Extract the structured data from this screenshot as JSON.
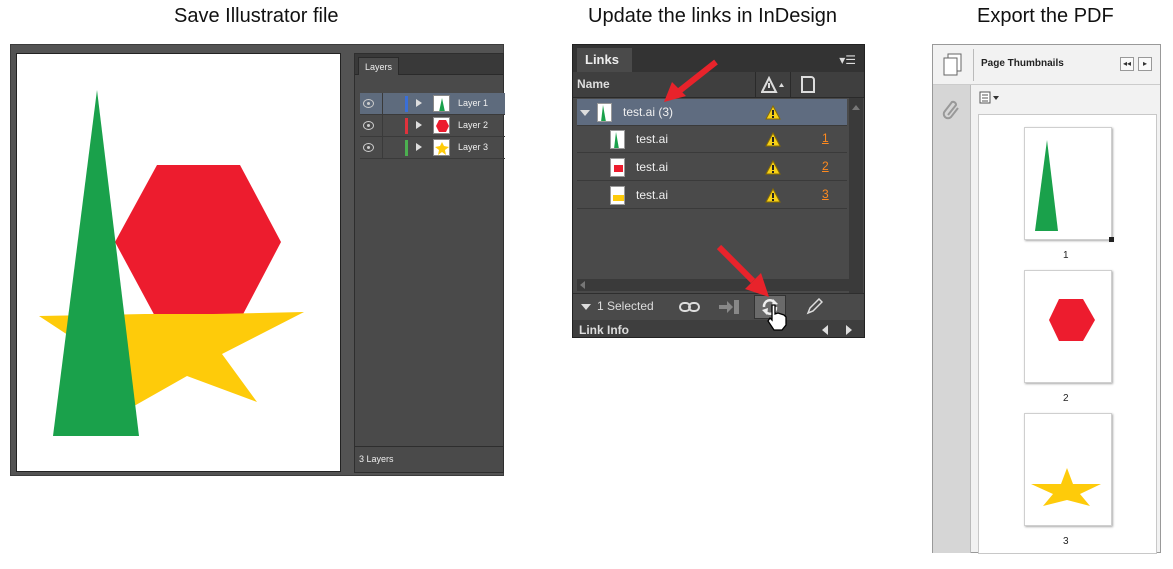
{
  "captions": {
    "illustrator": "Save Illustrator file",
    "indesign": "Update the links in InDesign",
    "pdf": "Export the PDF"
  },
  "illustrator": {
    "layers_tab": "Layers",
    "layers": [
      {
        "name": "Layer 1",
        "color": "#3a6fd8",
        "thumb": "triangle"
      },
      {
        "name": "Layer 2",
        "color": "#e0323c",
        "thumb": "hexagon"
      },
      {
        "name": "Layer 3",
        "color": "#4caf50",
        "thumb": "star"
      }
    ],
    "footer": "3 Layers"
  },
  "indesign": {
    "tab": "Links",
    "column_name": "Name",
    "parent": {
      "name": "test.ai (3)"
    },
    "children": [
      {
        "name": "test.ai",
        "page": "1",
        "thumb": "triangle"
      },
      {
        "name": "test.ai",
        "page": "2",
        "thumb": "hexagon"
      },
      {
        "name": "test.ai",
        "page": "3",
        "thumb": "star"
      }
    ],
    "selected_label": "1 Selected",
    "link_info": "Link Info"
  },
  "pdf": {
    "title": "Page Thumbnails",
    "pages": [
      {
        "number": "1",
        "shape": "triangle"
      },
      {
        "number": "2",
        "shape": "hexagon"
      },
      {
        "number": "3",
        "shape": "star"
      }
    ]
  },
  "colors": {
    "green": "#1aa14b",
    "red": "#ed1c2e",
    "yellow": "#fecb0a",
    "arrow": "#e8232b",
    "warning": "#f7d117"
  }
}
